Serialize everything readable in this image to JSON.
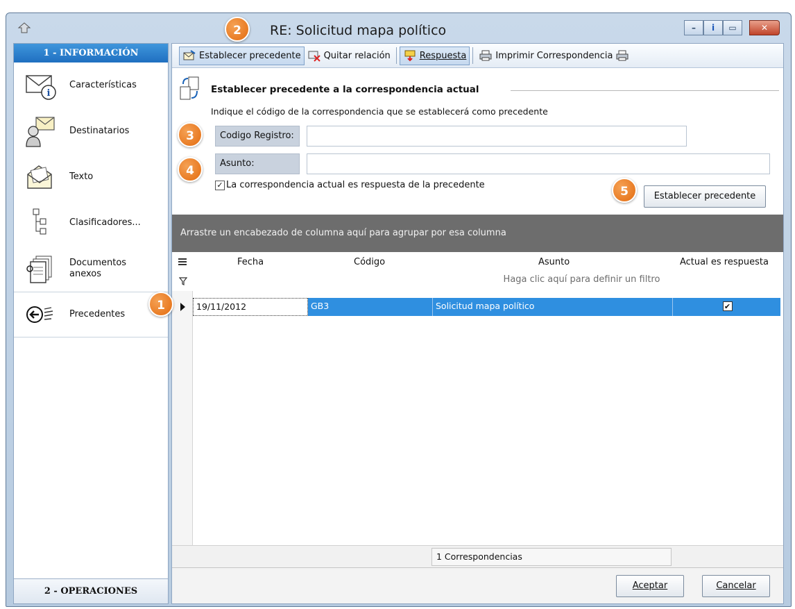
{
  "window": {
    "title": "RE: Solicitud mapa político",
    "controls": {
      "minimize": "–",
      "info": "i",
      "restore": "▭",
      "close": "✕"
    }
  },
  "sidebar": {
    "top_header": "1 - INFORMACIÓN",
    "items": [
      {
        "label": "Características",
        "icon": "envelope-info-icon"
      },
      {
        "label": "Destinatarios",
        "icon": "recipients-icon"
      },
      {
        "label": "Texto",
        "icon": "letter-text-icon"
      },
      {
        "label": "Clasificadores...",
        "icon": "tree-classifier-icon"
      },
      {
        "label": "Documentos anexos",
        "icon": "attached-documents-icon"
      },
      {
        "label": "Precedentes",
        "icon": "precedent-arrow-icon"
      }
    ],
    "bottom_header": "2 - OPERACIONES"
  },
  "toolbar": {
    "establecer": "Establecer precedente",
    "quitar": "Quitar relación",
    "respuesta": "Respuesta",
    "imprimir": "Imprimir Correspondencia"
  },
  "form": {
    "group_title": "Establecer precedente a la correspondencia actual",
    "description": "Indique el código de la correspondencia que se establecerá como precedente",
    "codigo_label": "Codigo Registro:",
    "codigo_value": "",
    "asunto_label": "Asunto:",
    "asunto_value": "",
    "checkbox_label": "La correspondencia actual es respuesta de la precedente",
    "checkbox_checked": true,
    "set_button": "Establecer precedente"
  },
  "grid": {
    "group_hint": "Arrastre un encabezado de columna aquí para agrupar por esa columna",
    "columns": [
      "Fecha",
      "Código",
      "Asunto",
      "Actual es respuesta"
    ],
    "filter_hint": "Haga clic aquí para definir un filtro",
    "rows": [
      {
        "fecha": "19/11/2012",
        "codigo": "GB3",
        "asunto": "Solicitud mapa político",
        "actual_es_respuesta": "✔"
      }
    ],
    "footer_count": "1 Correspondencias"
  },
  "dialog": {
    "ok": "Aceptar",
    "cancel": "Cancelar"
  },
  "callouts": [
    "1",
    "2",
    "3",
    "4",
    "5"
  ],
  "colors": {
    "accent": "#1f6fc0",
    "selection": "#2f8fe0",
    "callout": "#e36b0f",
    "group_bar": "#6d6d6d"
  }
}
